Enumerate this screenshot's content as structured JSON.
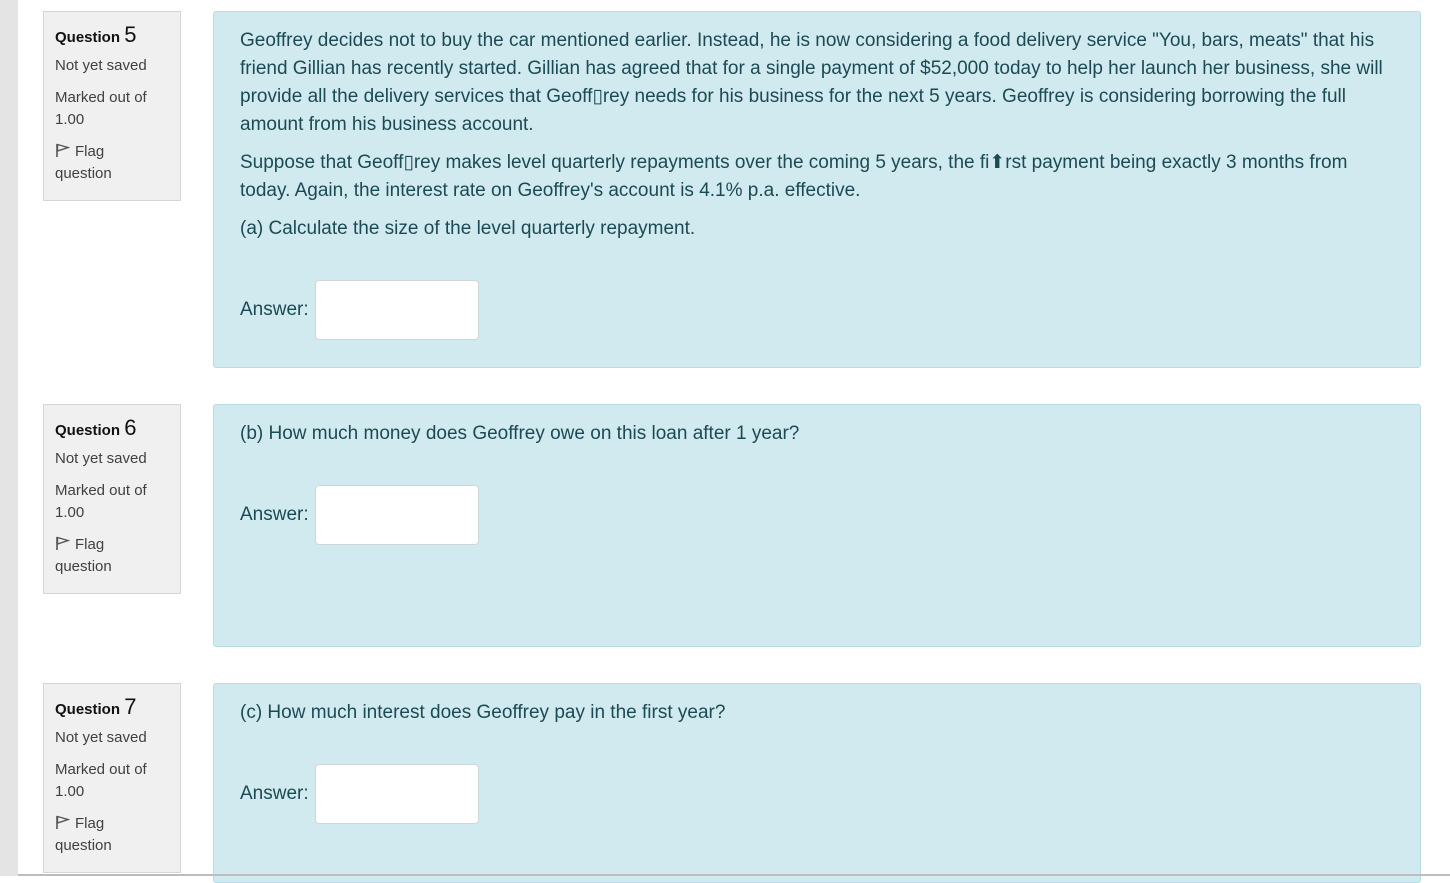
{
  "questions": [
    {
      "label": "Question",
      "number": "5",
      "state": "Not yet saved",
      "grade_line1": "Marked out of",
      "grade_line2": "1.00",
      "flag_line1": "Flag",
      "flag_line2": "question",
      "paragraphs": [
        "Geoffrey decides not to buy the car mentioned earlier. Instead, he is now considering a food delivery service \"You, bars, meats\" that his friend Gillian has recently started. Gillian has agreed that for a single payment of $52,000 today to help her launch her business, she will provide all the delivery services that Geoff▯rey needs for his business for the next 5 years. Geoffrey is considering borrowing the full amount from his business account.",
        "Suppose that Geoff▯rey makes level quarterly repayments over the coming 5 years, the fi⬆rst payment being exactly 3 months from today. Again, the interest rate on Geoffrey's account is 4.1% p.a. effective.",
        "(a) Calculate the size of the level quarterly repayment."
      ],
      "answer_label": "Answer:",
      "answer_value": ""
    },
    {
      "label": "Question",
      "number": "6",
      "state": "Not yet saved",
      "grade_line1": "Marked out of",
      "grade_line2": "1.00",
      "flag_line1": "Flag",
      "flag_line2": "question",
      "paragraphs": [
        "(b) How much money does Geoffrey owe on this loan after 1 year?"
      ],
      "answer_label": "Answer:",
      "answer_value": ""
    },
    {
      "label": "Question",
      "number": "7",
      "state": "Not yet saved",
      "grade_line1": "Marked out of",
      "grade_line2": "1.00",
      "flag_line1": "Flag",
      "flag_line2": "question",
      "paragraphs": [
        "(c) How much interest does Geoffrey pay in the first year?"
      ],
      "answer_label": "Answer:",
      "answer_value": ""
    }
  ]
}
